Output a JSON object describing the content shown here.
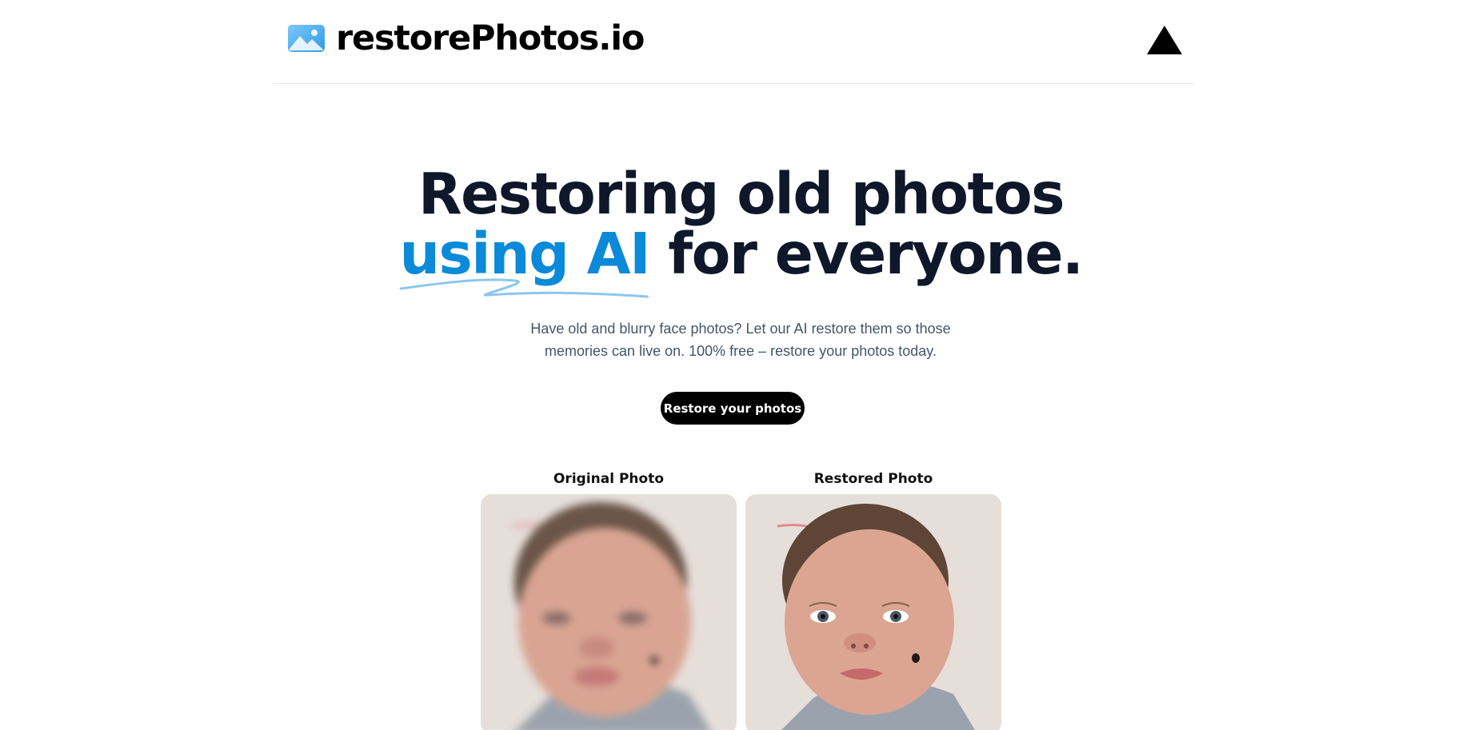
{
  "header": {
    "brand_name": "restorePhotos.io",
    "brand_icon": "image-icon",
    "deploy_icon": "vercel-triangle-icon"
  },
  "hero": {
    "headline_line1": "Restoring old photos",
    "headline_accent": "using AI",
    "headline_rest": " for everyone.",
    "subtitle": "Have old and blurry face photos? Let our AI restore them so those memories can live on. 100% free – restore your photos today.",
    "cta_label": "Restore your photos"
  },
  "comparison": {
    "original_label": "Original Photo",
    "restored_label": "Restored Photo"
  },
  "colors": {
    "accent": "#0a8ad8",
    "text": "#0f172a",
    "cta_bg": "#000000"
  }
}
